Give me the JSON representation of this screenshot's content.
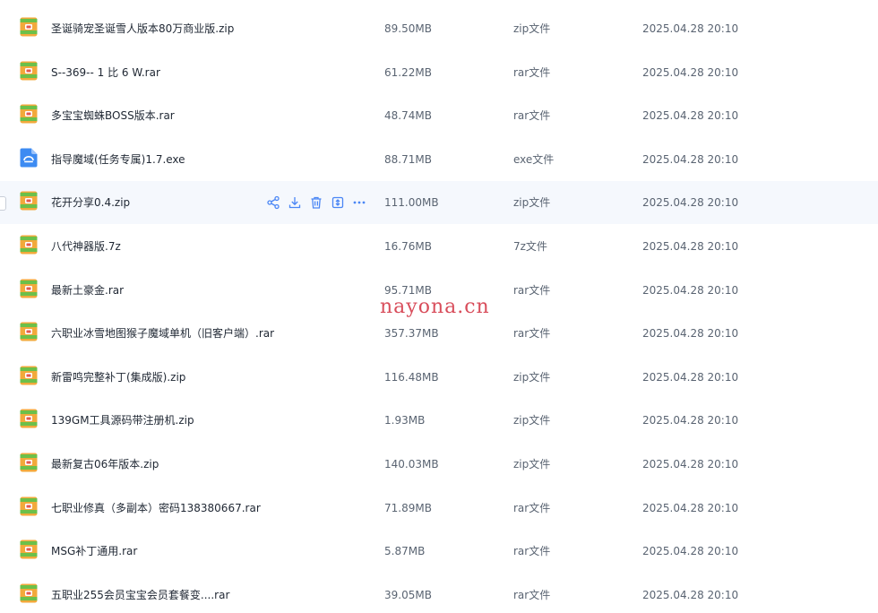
{
  "colors": {
    "archive_icon_bg": "#f2a93b",
    "archive_icon_strip_green": "#6cc04a",
    "archive_icon_strip_red": "#e5584f",
    "exe_icon_bg": "#3d8bf2",
    "hover_row_bg": "#f5f8fd",
    "action_icon": "#4a86f5",
    "watermark": "#d22f3f"
  },
  "files": [
    {
      "name": "圣诞骑宠圣诞雪人版本80万商业版.zip",
      "size": "89.50MB",
      "type": "zip文件",
      "date": "2025.04.28 20:10",
      "icon": "archive-icon"
    },
    {
      "name": "S--369-- 1 比 6 W.rar",
      "size": "61.22MB",
      "type": "rar文件",
      "date": "2025.04.28 20:10",
      "icon": "archive-icon"
    },
    {
      "name": "多宝宝蜘蛛BOSS版本.rar",
      "size": "48.74MB",
      "type": "rar文件",
      "date": "2025.04.28 20:10",
      "icon": "archive-icon"
    },
    {
      "name": "指导魔域(任务专属)1.7.exe",
      "size": "88.71MB",
      "type": "exe文件",
      "date": "2025.04.28 20:10",
      "icon": "exe-icon"
    },
    {
      "name": "花开分享0.4.zip",
      "size": "111.00MB",
      "type": "zip文件",
      "date": "2025.04.28 20:10",
      "icon": "archive-icon"
    },
    {
      "name": "八代神器版.7z",
      "size": "16.76MB",
      "type": "7z文件",
      "date": "2025.04.28 20:10",
      "icon": "archive-icon"
    },
    {
      "name": "最新土豪金.rar",
      "size": "95.71MB",
      "type": "rar文件",
      "date": "2025.04.28 20:10",
      "icon": "archive-icon"
    },
    {
      "name": "六职业冰雪地图猴子魔域单机（旧客户端）.rar",
      "size": "357.37MB",
      "type": "rar文件",
      "date": "2025.04.28 20:10",
      "icon": "archive-icon"
    },
    {
      "name": "新雷鸣完整补丁(集成版).zip",
      "size": "116.48MB",
      "type": "zip文件",
      "date": "2025.04.28 20:10",
      "icon": "archive-icon"
    },
    {
      "name": "139GM工具源码带注册机.zip",
      "size": "1.93MB",
      "type": "zip文件",
      "date": "2025.04.28 20:10",
      "icon": "archive-icon"
    },
    {
      "name": "最新复古06年版本.zip",
      "size": "140.03MB",
      "type": "zip文件",
      "date": "2025.04.28 20:10",
      "icon": "archive-icon"
    },
    {
      "name": "七职业修真（多副本）密码138380667.rar",
      "size": "71.89MB",
      "type": "rar文件",
      "date": "2025.04.28 20:10",
      "icon": "archive-icon"
    },
    {
      "name": "MSG补丁通用.rar",
      "size": "5.87MB",
      "type": "rar文件",
      "date": "2025.04.28 20:10",
      "icon": "archive-icon"
    },
    {
      "name": "五职业255会员宝宝会员套餐变....rar",
      "size": "39.05MB",
      "type": "rar文件",
      "date": "2025.04.28 20:10",
      "icon": "archive-icon"
    }
  ],
  "hovered_row_index": 4,
  "row_actions": [
    {
      "name": "share-icon"
    },
    {
      "name": "download-icon"
    },
    {
      "name": "trash-icon"
    },
    {
      "name": "move-icon"
    },
    {
      "name": "more-icon"
    }
  ],
  "watermark": "nayona.cn"
}
